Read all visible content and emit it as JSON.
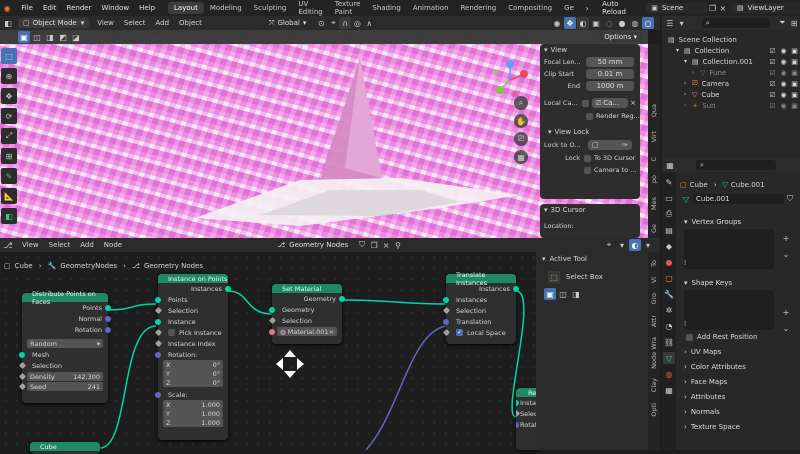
{
  "topbar": {
    "menus": [
      "File",
      "Edit",
      "Render",
      "Window",
      "Help"
    ],
    "workspaces": [
      "Layout",
      "Modeling",
      "Sculpting",
      "UV Editing",
      "Texture Paint",
      "Shading",
      "Animation",
      "Rendering",
      "Compositing",
      "Ge"
    ],
    "active_workspace": "Layout",
    "auto_reload": "Auto Reload",
    "scene": "Scene",
    "view_layer": "ViewLayer"
  },
  "viewport_header": {
    "mode": "Object Mode",
    "menus": [
      "View",
      "Select",
      "Add",
      "Object"
    ],
    "orientation": "Global",
    "options": "Options"
  },
  "view_panel": {
    "section_view": "View",
    "focal_length_label": "Focal Len...",
    "focal_length_value": "50 mm",
    "clip_start_label": "Clip Start",
    "clip_start_value": "0.01 m",
    "end_label": "End",
    "end_value": "1000 m",
    "local_camera_label": "Local Ca...",
    "local_camera_value": "Ca...",
    "render_region": "Render Reg...",
    "section_view_lock": "View Lock",
    "lock_to_object": "Lock to O...",
    "lock_label": "Lock",
    "to_3d_cursor": "To 3D Cursor",
    "camera_to": "Camera to ...",
    "section_3d_cursor": "3D Cursor",
    "location_label": "Location:"
  },
  "viewport_side_tabs": [
    "Qua",
    "Virt",
    "C",
    "po",
    "Mes",
    "Ge"
  ],
  "outliner": {
    "title": "Scene Collection",
    "items": [
      {
        "label": "Collection",
        "indent": 1,
        "icon": "collection"
      },
      {
        "label": "Collection.001",
        "indent": 2,
        "icon": "collection"
      },
      {
        "label": "Fune",
        "indent": 3,
        "icon": "object",
        "dim": true
      },
      {
        "label": "Camera",
        "indent": 2,
        "icon": "camera"
      },
      {
        "label": "Cube",
        "indent": 2,
        "icon": "mesh"
      },
      {
        "label": "Sun",
        "indent": 2,
        "icon": "light",
        "dim": true
      }
    ]
  },
  "node_header": {
    "menus": [
      "View",
      "Select",
      "Add",
      "Node"
    ],
    "tree_name": "Geometry Nodes"
  },
  "breadcrumb": [
    "Cube",
    "GeometryNodes",
    "Geometry Nodes"
  ],
  "nodes": {
    "distribute": {
      "title": "Distribute Points on Faces",
      "outputs": [
        "Points",
        "Normal",
        "Rotation"
      ],
      "mode": "Random",
      "inputs": [
        "Mesh",
        "Selection"
      ],
      "density_label": "Density",
      "density_value": "142.300",
      "seed_label": "Seed",
      "seed_value": "241"
    },
    "instance": {
      "title": "Instance on Points",
      "output": "Instances",
      "inputs": [
        "Points",
        "Selection",
        "Instance"
      ],
      "pick_instance": "Pick Instance",
      "instance_index": "Instance Index",
      "rotation_label": "Rotation:",
      "rotation": [
        {
          "axis": "X",
          "value": "0°"
        },
        {
          "axis": "Y",
          "value": "0°"
        },
        {
          "axis": "Z",
          "value": "0°"
        }
      ],
      "scale_label": "Scale:",
      "scale": [
        {
          "axis": "X",
          "value": "1.000"
        },
        {
          "axis": "Y",
          "value": "1.000"
        },
        {
          "axis": "Z",
          "value": "1.000"
        }
      ]
    },
    "set_material": {
      "title": "Set Material",
      "output": "Geometry",
      "inputs": [
        "Geometry",
        "Selection"
      ],
      "material": "Material.001"
    },
    "translate": {
      "title": "Translate Instances",
      "output": "Instances",
      "inputs": [
        "Instances",
        "Selection",
        "Translation"
      ],
      "local_space": "Local Space"
    },
    "cube": {
      "title": "Cube"
    },
    "realize": {
      "title": "Re",
      "inputs": [
        "Insta",
        "Selec",
        "Rotati"
      ]
    }
  },
  "active_tool": {
    "title": "Active Tool",
    "tool": "Select Box"
  },
  "node_side_tabs": [
    "To",
    "Vi",
    "Gro",
    "Attr",
    "Node Wra",
    "Clay",
    "Opti"
  ],
  "properties": {
    "object": "Cube",
    "mesh": "Cube.001",
    "data_name": "Cube.001",
    "sections": [
      "Vertex Groups",
      "Shape Keys",
      "UV Maps",
      "Color Attributes",
      "Face Maps",
      "Attributes",
      "Normals",
      "Texture Space"
    ],
    "add_rest_position": "Add Rest Position"
  },
  "colors": {
    "accent": "#4772b3",
    "geometry_header": "#1e8a64",
    "geometry_socket": "#00d6a3",
    "vector_socket": "#6363c7",
    "material_socket": "#eb7582"
  }
}
